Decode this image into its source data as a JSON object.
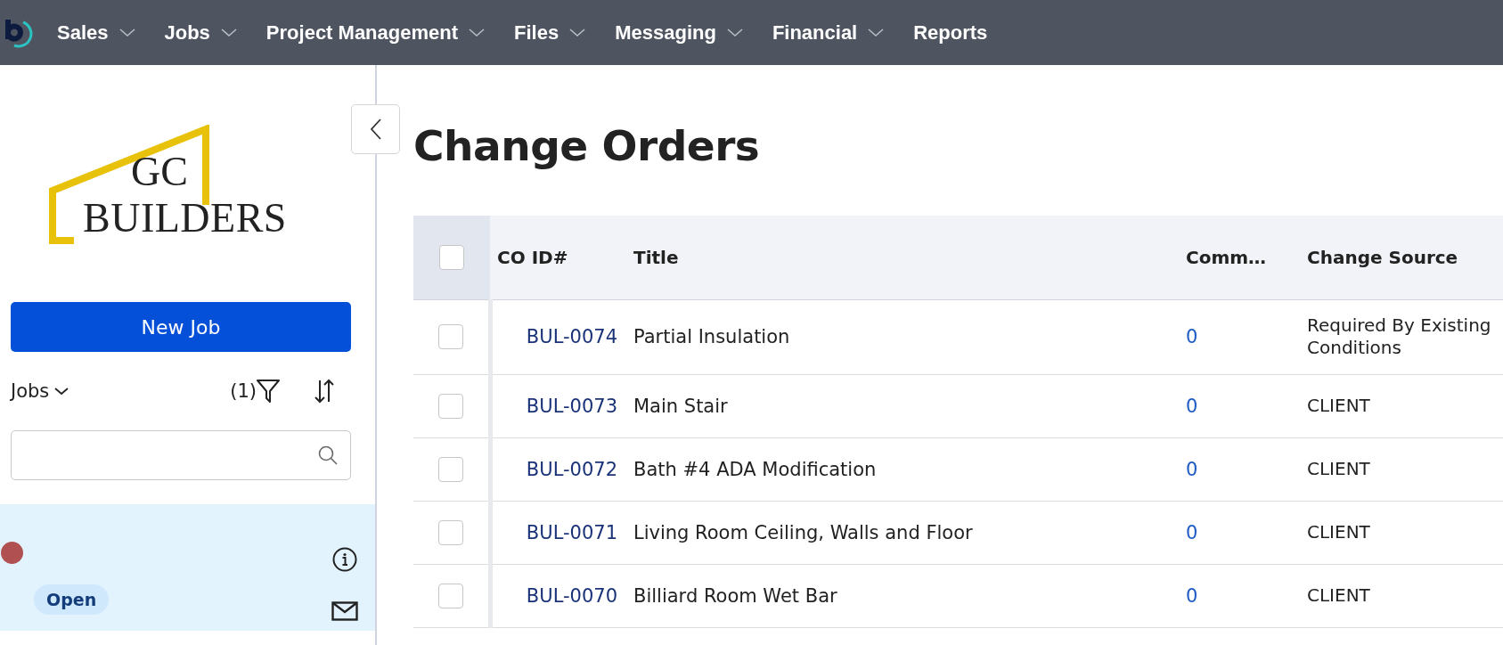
{
  "nav": {
    "items": [
      {
        "label": "Sales",
        "dropdown": true
      },
      {
        "label": "Jobs",
        "dropdown": true
      },
      {
        "label": "Project Management",
        "dropdown": true
      },
      {
        "label": "Files",
        "dropdown": true
      },
      {
        "label": "Messaging",
        "dropdown": true
      },
      {
        "label": "Financial",
        "dropdown": true
      },
      {
        "label": "Reports",
        "dropdown": false
      }
    ]
  },
  "sidebar": {
    "logo": {
      "line_1": "GC",
      "line_2": "BUILDERS"
    },
    "new_job_button": "New Job",
    "jobs_dropdown": "Jobs",
    "filter_count": "(1)",
    "job_items": [
      {
        "selected": true,
        "color": "#b05050",
        "status": "Open"
      }
    ]
  },
  "page": {
    "title": "Change Orders"
  },
  "table": {
    "all_checked": false,
    "columns": [
      "CO ID#",
      "Title",
      "Comm…",
      "Change Source"
    ],
    "rows": [
      {
        "checked": false,
        "id": "BUL-0074",
        "title": "Partial Insulation",
        "comments": "0",
        "source": "Required By Existing Conditions"
      },
      {
        "checked": false,
        "id": "BUL-0073",
        "title": "Main Stair",
        "comments": "0",
        "source": "CLIENT"
      },
      {
        "checked": false,
        "id": "BUL-0072",
        "title": "Bath #4 ADA Modification",
        "comments": "0",
        "source": "CLIENT"
      },
      {
        "checked": false,
        "id": "BUL-0071",
        "title": "Living Room Ceiling, Walls and Floor",
        "comments": "0",
        "source": "CLIENT"
      },
      {
        "checked": false,
        "id": "BUL-0070",
        "title": "Billiard Room Wet Bar",
        "comments": "0",
        "source": "CLIENT"
      }
    ]
  }
}
